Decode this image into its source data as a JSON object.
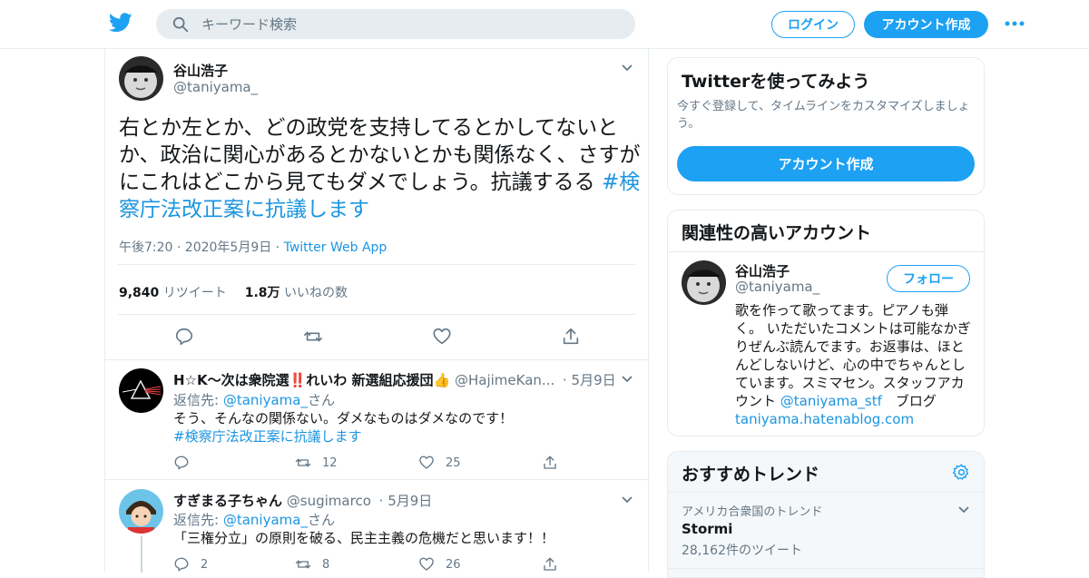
{
  "header": {
    "search_placeholder": "キーワード検索",
    "login_label": "ログイン",
    "signup_label": "アカウント作成"
  },
  "tweet": {
    "author_name": "谷山浩子",
    "author_handle": "@taniyama_",
    "text_main": "右とか左とか、どの政党を支持してるとかしてないとか、政治に関心があるとかないとかも関係なく、さすがにこれはどこから見てもダメでしょう。抗議するる ",
    "hashtag": "#検察庁法改正案に抗議します",
    "timestamp": "午後7:20 · 2020年5月9日 · ",
    "source": "Twitter Web App",
    "retweet_count": "9,840",
    "retweet_label": "リツイート",
    "like_count": "1.8万",
    "like_label": "いいねの数"
  },
  "replies": [
    {
      "name": "H☆K〜次は衆院選‼️れいわ 新選組応援団👍",
      "handle": "@HajimeKan...",
      "date": "· 5月9日",
      "reply_prefix": "返信先: ",
      "reply_to": "@taniyama_",
      "reply_suffix": "さん",
      "text": "そう、そんなの関係ない。ダメなものはダメなのです！",
      "hashtag": "#検察庁法改正案に抗議します",
      "retweets": "12",
      "likes": "25"
    },
    {
      "name": "すぎまる子ちゃん",
      "handle": "@sugimarco",
      "date": "· 5月9日",
      "reply_prefix": "返信先: ",
      "reply_to": "@taniyama_",
      "reply_suffix": "さん",
      "text": "「三権分立」の原則を破る、民主主義の危機だと思います！！",
      "replies": "2",
      "retweets": "8",
      "likes": "26"
    }
  ],
  "sidebar": {
    "signup_card": {
      "title": "Twitterを使ってみよう",
      "description": "今すぐ登録して、タイムラインをカスタマイズしましょう。",
      "button": "アカウント作成"
    },
    "related_card": {
      "title": "関連性の高いアカウント",
      "name": "谷山浩子",
      "handle": "@taniyama_",
      "follow_label": "フォロー",
      "bio": "歌を作って歌ってます。ピアノも弾く。 いただいたコメントは可能なかぎりぜんぶ読んでます。お返事は、ほとんどしないけど、心の中でちゃんとしています。スミマセン。スタッフアカウント ",
      "bio_mention": "@taniyama_stf",
      "bio_blog_label": "　ブログ",
      "bio_link": "taniyama.hatenablog.com"
    },
    "trends_card": {
      "title": "おすすめトレンド",
      "items": [
        {
          "context": "アメリカ合衆国のトレンド",
          "name": "Stormi",
          "count": "28,162件のツイート"
        }
      ]
    }
  },
  "colors": {
    "accent": "#1da1f2",
    "link": "#1b95e0",
    "muted": "#657786",
    "border": "#e6ecf0"
  }
}
